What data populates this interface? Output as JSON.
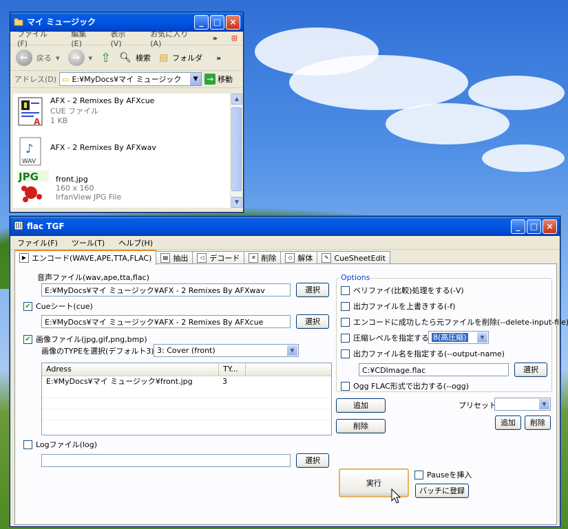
{
  "explorer": {
    "title": "マイ ミュージック",
    "menu": [
      "ファイル(F)",
      "編集(E)",
      "表示(V)",
      "お気に入り(A)"
    ],
    "menu_more": "»",
    "toolbar": {
      "back": "戻る",
      "search": "検索",
      "folders": "フォルダ",
      "more": "»"
    },
    "address_label": "アドレス(D)",
    "address_value": "E:¥MyDocs¥マイ ミュージック",
    "go_label": "移動",
    "files": [
      {
        "name": "AFX - 2 Remixes By AFXcue",
        "type": "CUE ファイル",
        "size": "1 KB",
        "icon": "cue-file-icon"
      },
      {
        "name": "AFX - 2 Remixes By AFXwav",
        "type": "",
        "size": "",
        "icon": "wav-file-icon"
      },
      {
        "name": "front.jpg",
        "type": "160 x 160",
        "size": "IrfanView JPG File",
        "icon": "jpg-file-icon"
      }
    ],
    "icon_labels": {
      "wav": "WAV",
      "jpg": "JPG"
    }
  },
  "flac": {
    "title": "flac TGF",
    "menu": [
      "ファイル(F)",
      "ツール(T)",
      "ヘルプ(H)"
    ],
    "tabs": [
      "エンコード(WAVE,APE,TTA,FLAC)",
      "抽出",
      "デコード",
      "削除",
      "解体",
      "CueSheetEdit"
    ],
    "audio_label": "音声ファイル(wav,ape,tta,flac)",
    "audio_path": "E:¥MyDocs¥マイ ミュージック¥AFX - 2 Remixes By AFXwav",
    "cue_label": "Cueシート(cue)",
    "cue_path": "E:¥MyDocs¥マイ ミュージック¥AFX - 2 Remixes By AFXcue",
    "image_label": "画像ファイル(jpg,gif,png,bmp)",
    "image_type_label": "画像のTYPEを選択(デフォルト3)",
    "image_type_value": "3: Cover (front)",
    "list_headers": [
      "Adress",
      "TY..."
    ],
    "list_rows": [
      {
        "path": "E:¥MyDocs¥マイ ミュージック¥front.jpg",
        "type": "3"
      }
    ],
    "log_label": "Logファイル(log)",
    "log_path": "",
    "select_button": "選択",
    "add_button": "追加",
    "delete_button": "削除",
    "checks": {
      "cue": true,
      "image": true,
      "log": false
    },
    "options": {
      "legend": "Options",
      "verify": "ベリファイ(比較)処理をする(-V)",
      "overwrite": "出力ファイルを上書きする(-f)",
      "delete_input": "エンコードに成功したら元ファイルを削除(--delete-input-file)",
      "compression": "圧縮レベルを指定する",
      "compression_value": "8(高圧縮)",
      "output_name": "出力ファイル名を指定する(--output-name)",
      "output_value": "C:¥CDImage.flac",
      "ogg": "Ogg FLAC形式で出力する(--ogg)"
    },
    "preset_label": "プリセット",
    "preset_value": "",
    "run_button": "実行",
    "pause_label": "Pauseを挿入",
    "batch_button": "バッチに登録"
  }
}
